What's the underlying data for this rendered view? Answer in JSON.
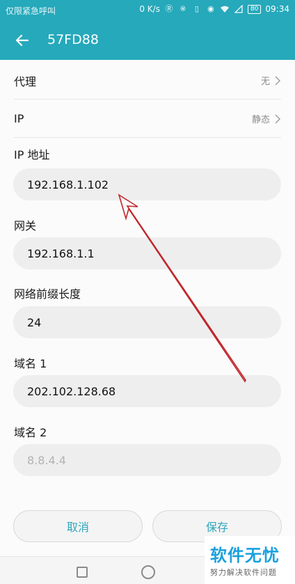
{
  "status_bar": {
    "carrier_text": "仅限紧急呼叫",
    "net_speed": "0 K/s",
    "battery": "80",
    "time": "09:34"
  },
  "app_bar": {
    "title": "57FD88"
  },
  "rows": {
    "proxy": {
      "label": "代理",
      "value": "无"
    },
    "ip": {
      "label": "IP",
      "value": "静态"
    }
  },
  "fields": {
    "ip_address": {
      "label": "IP 地址",
      "value": "192.168.1.102"
    },
    "gateway": {
      "label": "网关",
      "value": "192.168.1.1"
    },
    "prefix_length": {
      "label": "网络前缀长度",
      "value": "24"
    },
    "dns1": {
      "label": "域名 1",
      "value": "202.102.128.68"
    },
    "dns2": {
      "label": "域名 2",
      "placeholder": "8.8.4.4"
    }
  },
  "buttons": {
    "cancel": "取消",
    "save": "保存"
  },
  "watermark": {
    "title": "软件无忧",
    "subtitle": "努力解决软件问题"
  },
  "colors": {
    "accent": "#26a9bb",
    "button_text": "#2fa6ba",
    "annotation_arrow": "#c0262b"
  }
}
